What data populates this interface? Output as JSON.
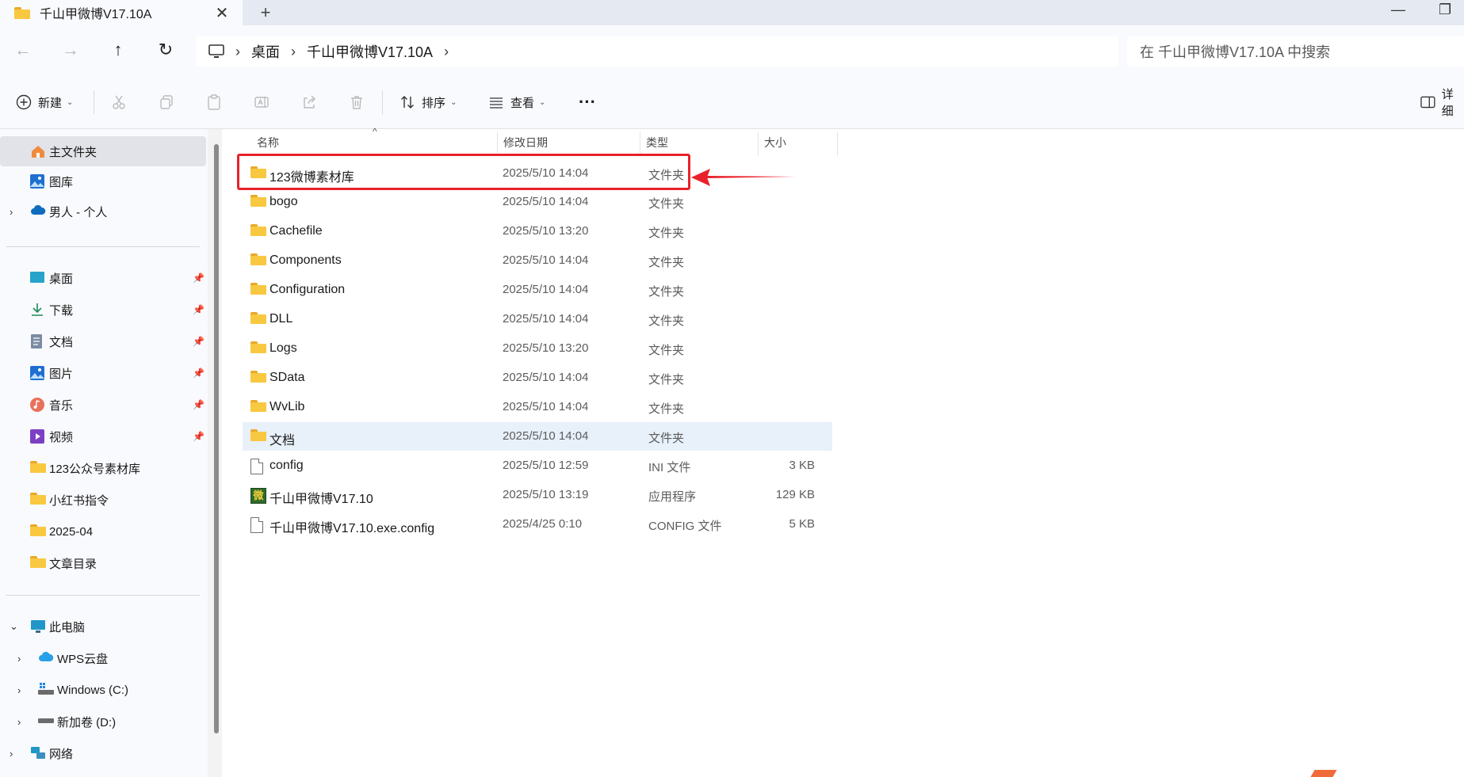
{
  "window": {
    "tab_title": "千山甲微博V17.10A",
    "close_glyph": "✕",
    "newtab_glyph": "+",
    "minimize_glyph": "—",
    "restore_glyph": "❐"
  },
  "addressbar": {
    "breadcrumbs": [
      "桌面",
      "千山甲微博V17.10A"
    ],
    "separator": "›",
    "search_placeholder": "在 千山甲微博V17.10A 中搜索"
  },
  "nav": {
    "back_glyph": "←",
    "forward_glyph": "→",
    "up_glyph": "↑",
    "refresh_glyph": "↻"
  },
  "toolbar": {
    "new_label": "新建",
    "sort_label": "排序",
    "view_label": "查看",
    "more_glyph": "···",
    "details_label": "详细"
  },
  "sidebar": {
    "home": "主文件夹",
    "gallery": "图库",
    "onedrive": "男人 - 个人",
    "quick": [
      "桌面",
      "下载",
      "文档",
      "图片",
      "音乐",
      "视频",
      "123公众号素材库",
      "小红书指令",
      "2025-04",
      "文章目录"
    ],
    "this_pc": "此电脑",
    "wps": "WPS云盘",
    "c_drive": "Windows (C:)",
    "d_drive": "新加卷 (D:)",
    "network": "网络"
  },
  "columns": {
    "name": "名称",
    "date": "修改日期",
    "type": "类型",
    "size": "大小"
  },
  "files": [
    {
      "name": "123微博素材库",
      "date": "2025/5/10 14:04",
      "type": "文件夹",
      "size": ""
    },
    {
      "name": "bogo",
      "date": "2025/5/10 14:04",
      "type": "文件夹",
      "size": ""
    },
    {
      "name": "Cachefile",
      "date": "2025/5/10 13:20",
      "type": "文件夹",
      "size": ""
    },
    {
      "name": "Components",
      "date": "2025/5/10 14:04",
      "type": "文件夹",
      "size": ""
    },
    {
      "name": "Configuration",
      "date": "2025/5/10 14:04",
      "type": "文件夹",
      "size": ""
    },
    {
      "name": "DLL",
      "date": "2025/5/10 14:04",
      "type": "文件夹",
      "size": ""
    },
    {
      "name": "Logs",
      "date": "2025/5/10 13:20",
      "type": "文件夹",
      "size": ""
    },
    {
      "name": "SData",
      "date": "2025/5/10 14:04",
      "type": "文件夹",
      "size": ""
    },
    {
      "name": "WvLib",
      "date": "2025/5/10 14:04",
      "type": "文件夹",
      "size": ""
    },
    {
      "name": "文档",
      "date": "2025/5/10 14:04",
      "type": "文件夹",
      "size": ""
    },
    {
      "name": "config",
      "date": "2025/5/10 12:59",
      "type": "INI 文件",
      "size": "3 KB"
    },
    {
      "name": "千山甲微博V17.10",
      "date": "2025/5/10 13:19",
      "type": "应用程序",
      "size": "129 KB"
    },
    {
      "name": "千山甲微博V17.10.exe.config",
      "date": "2025/4/25 0:10",
      "type": "CONFIG 文件",
      "size": "5 KB"
    }
  ],
  "app_icon_glyph": "微",
  "colors": {
    "accent": "#0067c0",
    "annotation": "#e8212a",
    "folder": "#f8c840",
    "highlight_row": "#e8f0fa",
    "selected_nav": "#e1e3e8"
  }
}
